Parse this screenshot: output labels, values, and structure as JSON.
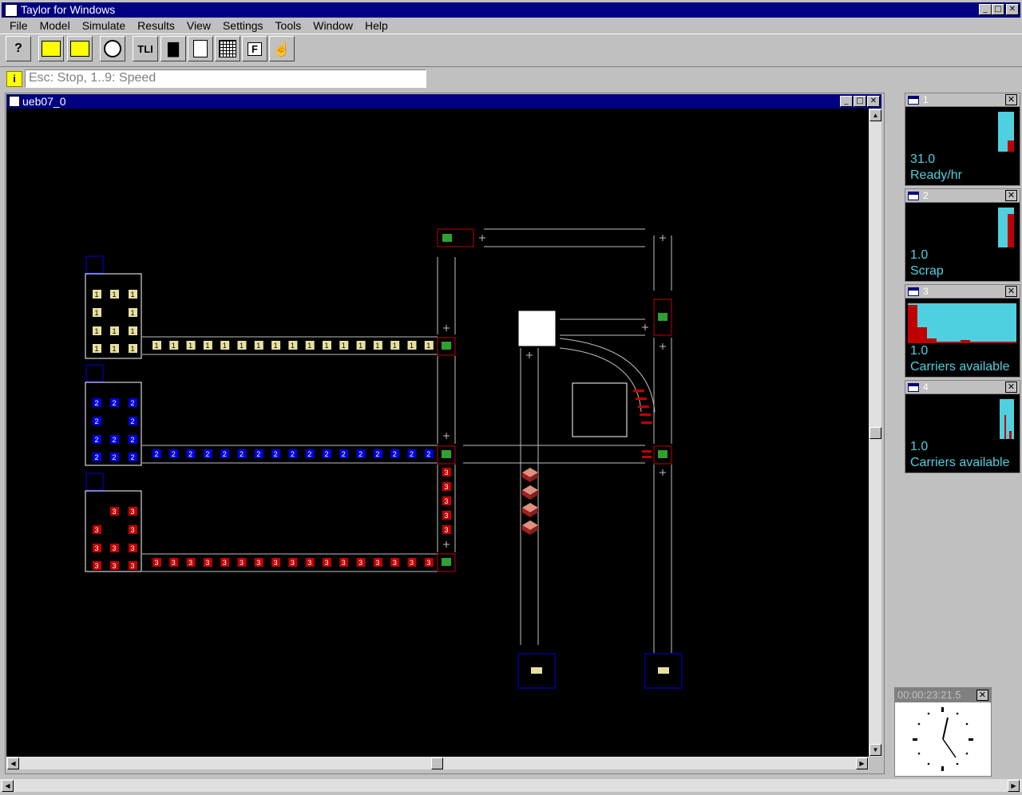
{
  "app": {
    "title": "Taylor for Windows"
  },
  "menu": [
    "File",
    "Model",
    "Simulate",
    "Results",
    "View",
    "Settings",
    "Tools",
    "Window",
    "Help"
  ],
  "toolbar": {
    "help_label": "?",
    "tli_label": "TLI",
    "f_label": "F"
  },
  "status": {
    "hint": "Esc: Stop, 1..9: Speed"
  },
  "model_window": {
    "title": "ueb07_0"
  },
  "layout": {
    "queue1_label": "1",
    "queue2_label": "2",
    "queue3_label": "3"
  },
  "monitors": [
    {
      "id": "1",
      "value": "31.0",
      "label": "Ready/hr"
    },
    {
      "id": "2",
      "value": "1.0",
      "label": "Scrap"
    },
    {
      "id": "3",
      "value": "1.0",
      "label": "Carriers available"
    },
    {
      "id": "4",
      "value": "1.0",
      "label": "Carriers available"
    }
  ],
  "clock": {
    "time": "00:00:23:21.5"
  },
  "colors": {
    "accent": "#000080",
    "monitor_text": "#4fd0e0",
    "conveyor_1": "#e8e0a0",
    "conveyor_2": "#0000e0",
    "conveyor_3": "#c00000"
  }
}
